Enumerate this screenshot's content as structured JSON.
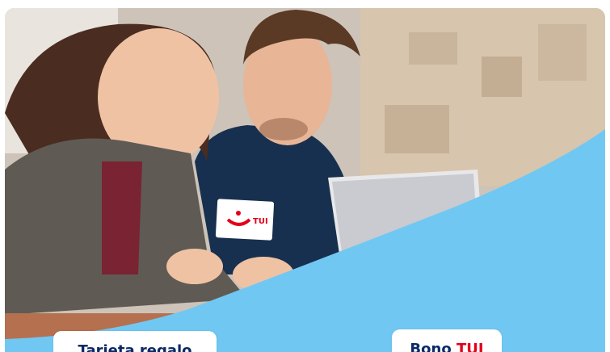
{
  "card_logo_text": "TUI",
  "cta_left": {
    "label": "Tarjeta regalo"
  },
  "cta_right": {
    "label": "Bono",
    "brand": "TUI"
  },
  "colors": {
    "wave": "#70c8f2",
    "navy": "#0a2a66",
    "tui_red": "#e2001a"
  }
}
